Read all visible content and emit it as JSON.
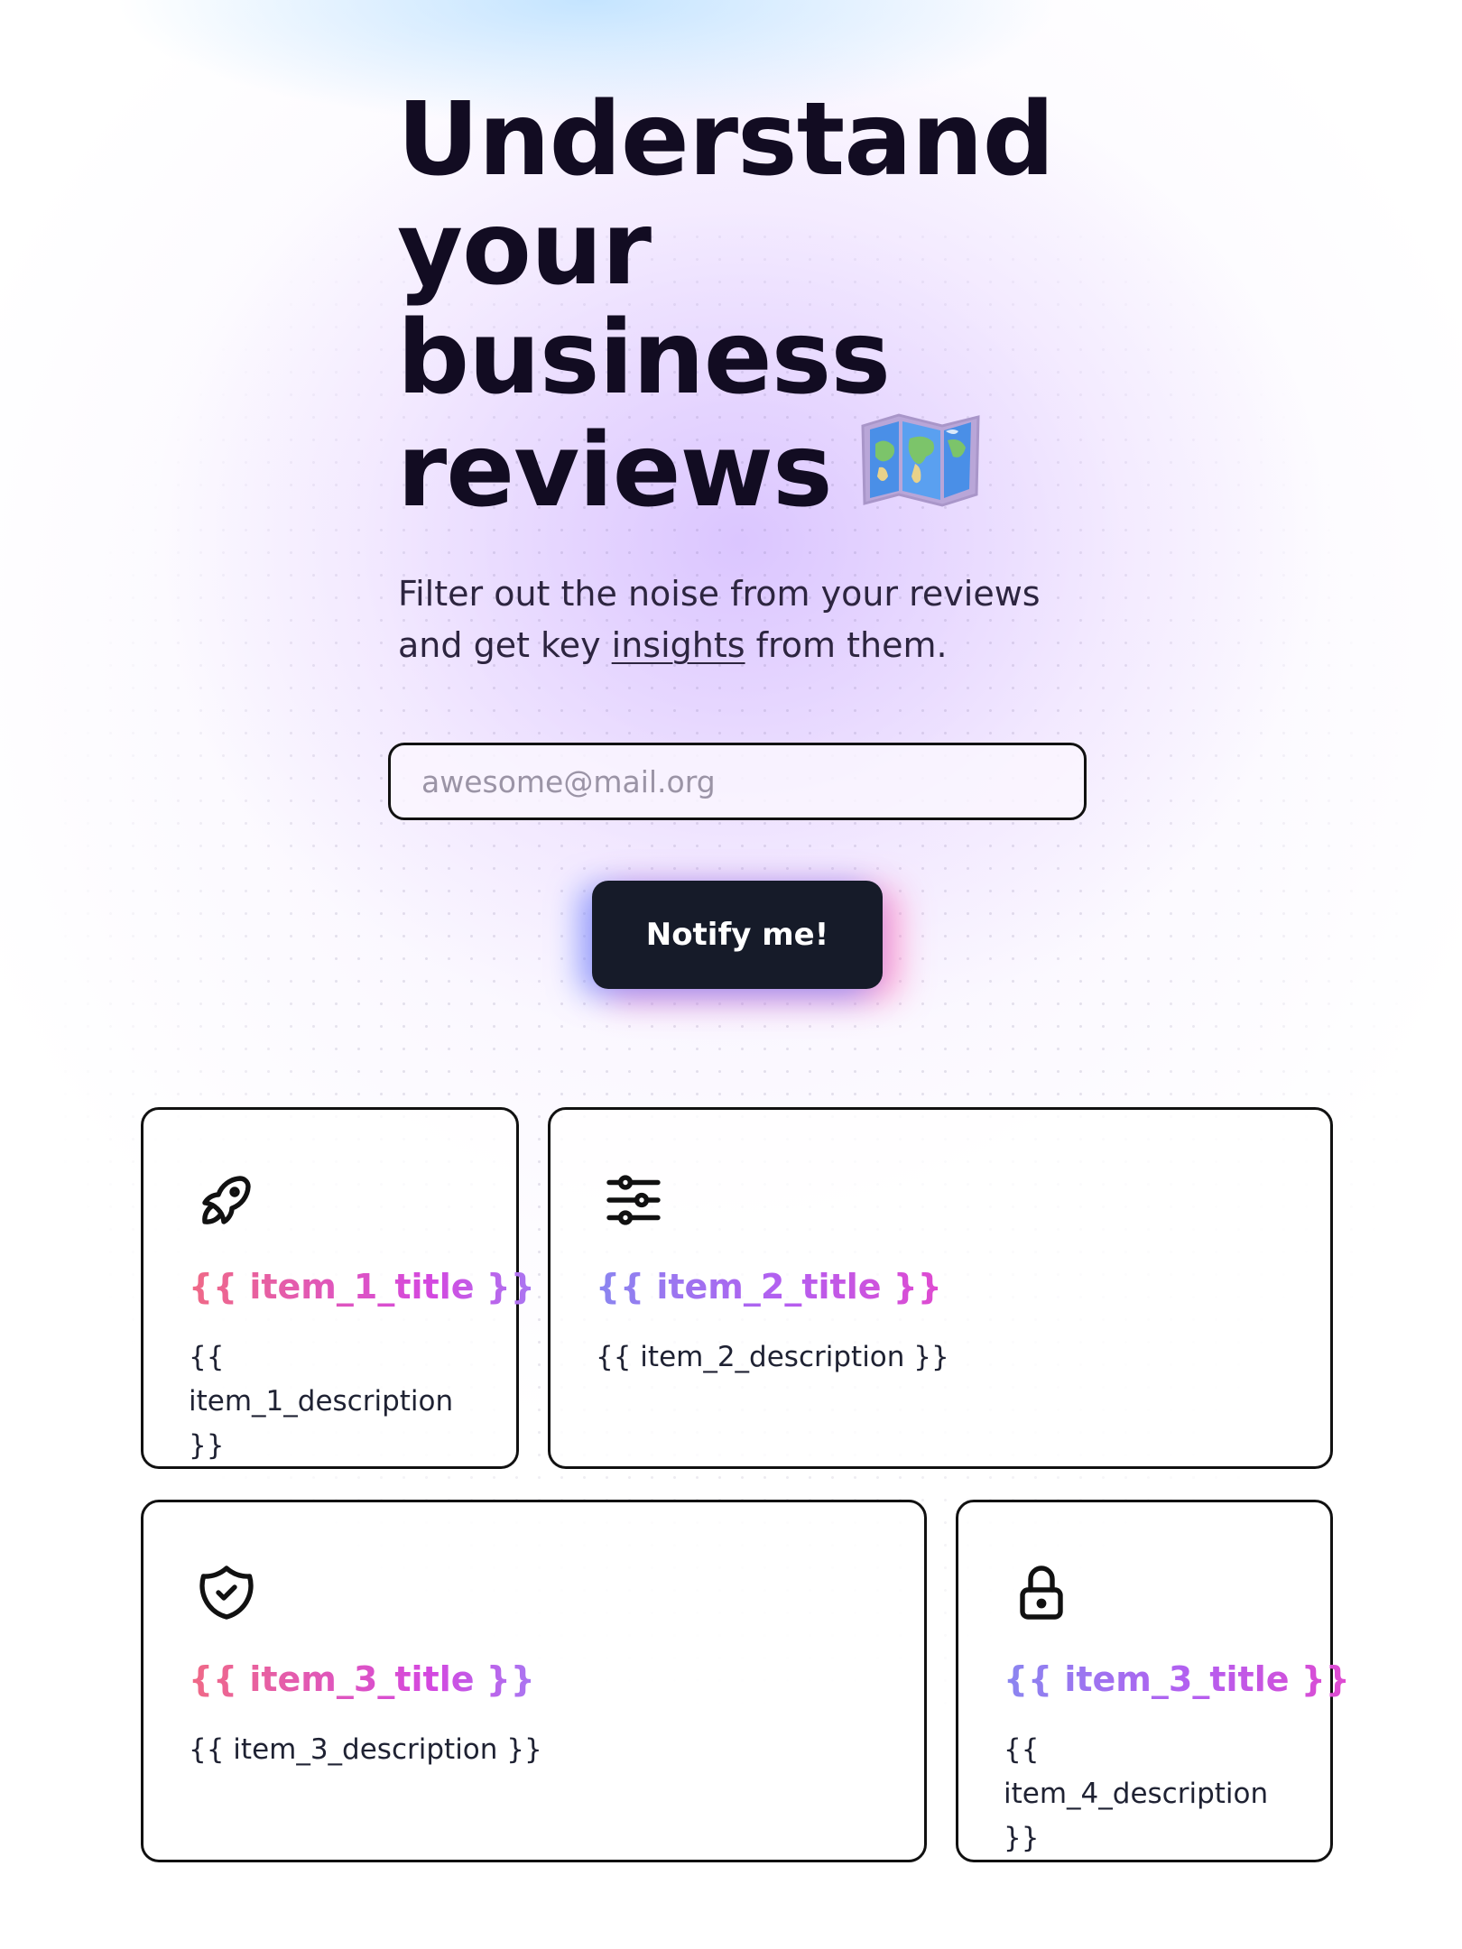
{
  "hero": {
    "title_lines": [
      "Understand",
      "your",
      "business",
      "reviews"
    ],
    "title_emoji": "world-map-emoji",
    "subtitle_part1": "Filter out the noise from your reviews and get key ",
    "subtitle_link": "insights",
    "subtitle_part2": " from them."
  },
  "signup": {
    "email_placeholder": "awesome@mail.org",
    "email_value": "",
    "button_label": "Notify me!"
  },
  "features": [
    {
      "icon": "rocket-icon",
      "title": "{{ item_1_title }}",
      "description": "{{ item_1_description }}"
    },
    {
      "icon": "sliders-icon",
      "title": "{{ item_2_title }}",
      "description": "{{ item_2_description }}"
    },
    {
      "icon": "shield-check-icon",
      "title": "{{ item_3_title }}",
      "description": "{{ item_3_description }}"
    },
    {
      "icon": "lock-icon",
      "title": "{{ item_3_title }}",
      "description": "{{ item_4_description }}"
    }
  ],
  "colors": {
    "button_bg": "#161b29",
    "title_text": "#120c22",
    "gradient_pink": "#f06a86",
    "gradient_magenta": "#d448e0",
    "gradient_indigo": "#8a86f0"
  }
}
